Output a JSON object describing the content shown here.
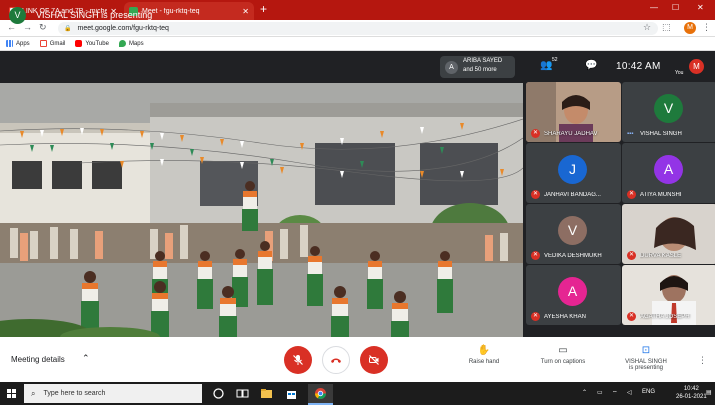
{
  "browser": {
    "tabs": [
      {
        "label": "LINK OF 7A and 7B - michelle.fr",
        "active": false,
        "icon": "gmail-icon"
      },
      {
        "label": "Meet - fgu-rktq-teq",
        "active": true,
        "icon": "meet-icon"
      }
    ],
    "url": "meet.google.com/fgu-rktq-teq",
    "bookmarks": [
      {
        "label": "Apps",
        "icon": "apps-grid-icon",
        "color": "#4285f4"
      },
      {
        "label": "Gmail",
        "icon": "gmail-icon",
        "color": "#ea4335"
      },
      {
        "label": "YouTube",
        "icon": "youtube-icon",
        "color": "#ff0000"
      },
      {
        "label": "Maps",
        "icon": "maps-icon",
        "color": "#34a853"
      }
    ],
    "profile_initial": "M"
  },
  "meet": {
    "presenter_initial": "V",
    "presenter_banner": "VISHAL SINGH is presenting",
    "viewer_initial": "A",
    "viewer_line1": "ARIBA SAYED",
    "viewer_line2": "and 50 more",
    "people_count": "52",
    "time": "10:42 AM",
    "self_label": "You",
    "self_initial": "M",
    "participants": [
      {
        "name": "SHARAYU JADHAV",
        "type": "video",
        "muted": true
      },
      {
        "name": "VISHAL SINGH",
        "type": "avatar",
        "initial": "V",
        "color": "#1e7a3c",
        "speaking": true
      },
      {
        "name": "JANHAVI BANDAG...",
        "type": "avatar",
        "initial": "J",
        "color": "#1967d2",
        "muted": true
      },
      {
        "name": "ATIYA MUNSHI",
        "type": "avatar",
        "initial": "A",
        "color": "#9334e6",
        "muted": true
      },
      {
        "name": "VEDIKA DESHMUKH",
        "type": "avatar",
        "initial": "V",
        "color": "#8d6e63",
        "muted": true
      },
      {
        "name": "DURVA KASLE",
        "type": "video",
        "muted": true
      },
      {
        "name": "AYESHA KHAN",
        "type": "avatar",
        "initial": "A",
        "color": "#e52592",
        "muted": true
      },
      {
        "name": "AGATHA JOSEPH",
        "type": "video",
        "muted": true
      }
    ],
    "controls": {
      "meeting_details": "Meeting details",
      "raise_hand": "Raise hand",
      "captions": "Turn on captions",
      "presenting_line1": "VISHAL SINGH",
      "presenting_line2": "is presenting"
    },
    "colors": {
      "danger": "#d93025",
      "accent": "#1a73e8"
    }
  },
  "taskbar": {
    "search_placeholder": "Type here to search",
    "lang": "ENG",
    "time": "10:42",
    "date": "26-01-2021"
  }
}
